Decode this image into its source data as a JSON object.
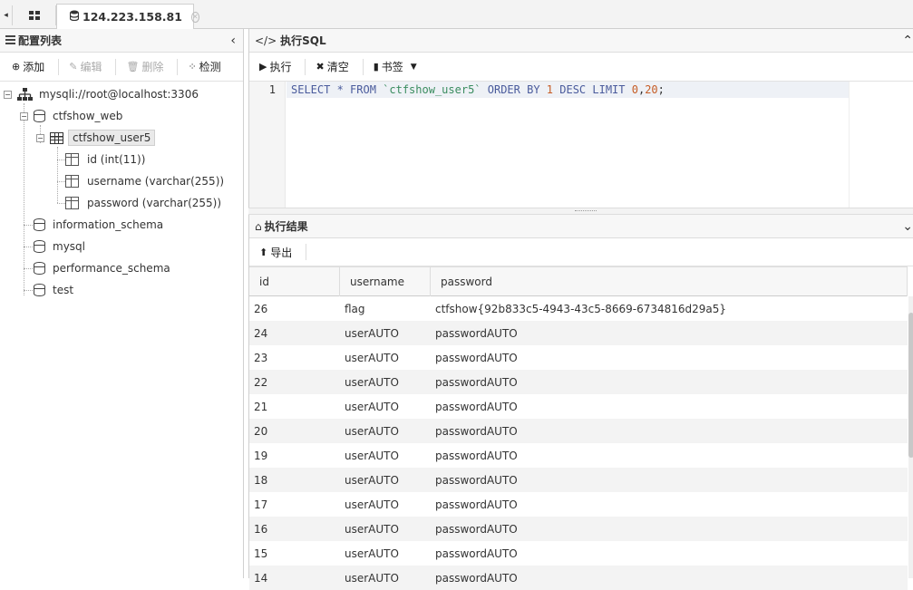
{
  "tabbar": {
    "prev_glyph": "◂",
    "grid_icon": "grid-icon",
    "active_tab": {
      "icon": "database-icon",
      "label": "124.223.158.81",
      "close_glyph": "✕"
    }
  },
  "left_panel": {
    "title": "配置列表",
    "collapse_glyph": "‹",
    "toolbar": {
      "add": "添加",
      "edit": "编辑",
      "delete": "删除",
      "check": "检测"
    },
    "tree": {
      "connection": "mysqli://root@localhost:3306",
      "db_web": "ctfshow_web",
      "table_user5": "ctfshow_user5",
      "col_id": "id (int(11))",
      "col_username": "username (varchar(255))",
      "col_password": "password (varchar(255))",
      "db_info": "information_schema",
      "db_mysql": "mysql",
      "db_perf": "performance_schema",
      "db_test": "test"
    }
  },
  "sql_panel": {
    "title": "执行SQL",
    "toolbar": {
      "execute": "执行",
      "clear": "清空",
      "bookmark": "书签"
    },
    "line_number": "1",
    "query": {
      "p1": "SELECT * FROM ",
      "table": "`ctfshow_user5`",
      "p2": " ORDER BY ",
      "n1": "1",
      "p3": " DESC LIMIT ",
      "n2": "0",
      "comma": ",",
      "n3": "20",
      "semi": ";"
    }
  },
  "result_panel": {
    "title": "执行结果",
    "export": "导出",
    "columns": [
      "id",
      "username",
      "password"
    ],
    "rows": [
      [
        "26",
        "flag",
        "ctfshow{92b833c5-4943-43c5-8669-6734816d29a5}"
      ],
      [
        "24",
        "userAUTO",
        "passwordAUTO"
      ],
      [
        "23",
        "userAUTO",
        "passwordAUTO"
      ],
      [
        "22",
        "userAUTO",
        "passwordAUTO"
      ],
      [
        "21",
        "userAUTO",
        "passwordAUTO"
      ],
      [
        "20",
        "userAUTO",
        "passwordAUTO"
      ],
      [
        "19",
        "userAUTO",
        "passwordAUTO"
      ],
      [
        "18",
        "userAUTO",
        "passwordAUTO"
      ],
      [
        "17",
        "userAUTO",
        "passwordAUTO"
      ],
      [
        "16",
        "userAUTO",
        "passwordAUTO"
      ],
      [
        "15",
        "userAUTO",
        "passwordAUTO"
      ],
      [
        "14",
        "userAUTO",
        "passwordAUTO"
      ]
    ]
  }
}
